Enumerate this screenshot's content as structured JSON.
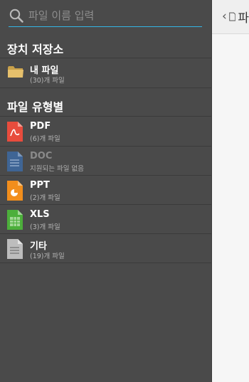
{
  "search": {
    "placeholder": "파일 이름 입력"
  },
  "device_storage": {
    "title": "장치 저장소",
    "items": [
      {
        "name": "내 파일",
        "sub": "(30)개 파일",
        "icon": "folder-icon"
      }
    ]
  },
  "file_types": {
    "title": "파일 유형별",
    "items": [
      {
        "name": "PDF",
        "sub": "(6)개 파일",
        "icon": "pdf-file-icon",
        "color": "#e84c3d"
      },
      {
        "name": "DOC",
        "sub": "지원되는 파일 없음",
        "icon": "doc-file-icon",
        "color": "#3f6595"
      },
      {
        "name": "PPT",
        "sub": "(2)개 파일",
        "icon": "ppt-file-icon",
        "color": "#f28e1c"
      },
      {
        "name": "XLS",
        "sub": "(3)개 파일",
        "icon": "xls-file-icon",
        "color": "#4caf3b"
      },
      {
        "name": "기타",
        "sub": "(19)개 파일",
        "icon": "generic-file-icon",
        "color": "#bdbdbd"
      }
    ]
  },
  "main": {
    "title": "파"
  }
}
